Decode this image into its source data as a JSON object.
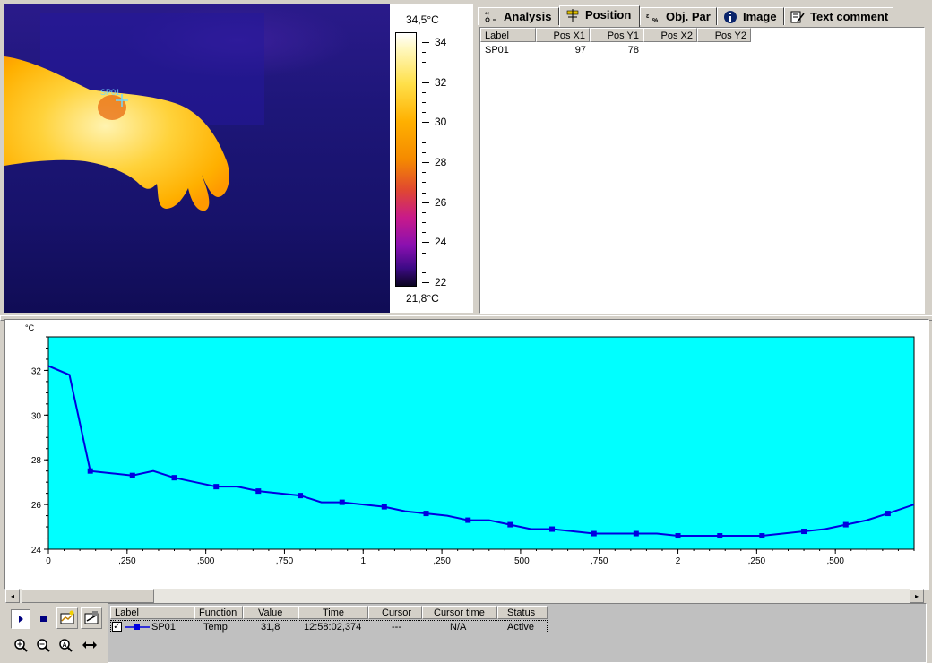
{
  "thermal": {
    "spot_label": "SP01",
    "scale_max": "34,5°C",
    "scale_min": "21,8°C",
    "scale_ticks": [
      "34",
      "32",
      "30",
      "28",
      "26",
      "24",
      "22"
    ]
  },
  "tabs": [
    {
      "label": "Analysis",
      "icon": "analysis-icon"
    },
    {
      "label": "Position",
      "icon": "position-icon"
    },
    {
      "label": "Obj. Par",
      "icon": "object-parameters-icon"
    },
    {
      "label": "Image",
      "icon": "info-icon"
    },
    {
      "label": "Text comment",
      "icon": "text-comment-icon"
    }
  ],
  "position_table": {
    "headers": [
      "Label",
      "Pos X1",
      "Pos Y1",
      "Pos X2",
      "Pos Y2"
    ],
    "rows": [
      [
        "SP01",
        "97",
        "78",
        "",
        ""
      ]
    ]
  },
  "chart_data": {
    "type": "line",
    "ylabel": "°C",
    "ylim": [
      24,
      33.5
    ],
    "yticks": [
      24,
      26,
      28,
      30,
      32
    ],
    "xlim": [
      0,
      2.75
    ],
    "xtick_labels": [
      "0",
      ",250",
      ",500",
      ",750",
      "1",
      ",250",
      ",500",
      ",750",
      "2",
      ",250",
      ",500"
    ],
    "xtick_values": [
      0,
      0.25,
      0.5,
      0.75,
      1,
      1.25,
      1.5,
      1.75,
      2,
      2.25,
      2.5
    ],
    "grid": false,
    "background": "#00ffff",
    "line_color": "#0000e0",
    "series": [
      {
        "x": [
          0,
          0.067,
          0.133,
          0.2,
          0.267,
          0.333,
          0.4,
          0.467,
          0.533,
          0.6,
          0.667,
          0.733,
          0.8,
          0.867,
          0.933,
          1.0,
          1.067,
          1.133,
          1.2,
          1.267,
          1.333,
          1.4,
          1.467,
          1.533,
          1.6,
          1.667,
          1.733,
          1.8,
          1.867,
          1.933,
          2.0,
          2.067,
          2.133,
          2.2,
          2.267,
          2.333,
          2.4,
          2.467,
          2.533,
          2.6,
          2.667,
          2.75
        ],
        "values": [
          32.2,
          31.8,
          27.5,
          27.4,
          27.3,
          27.5,
          27.2,
          27.0,
          26.8,
          26.8,
          26.6,
          26.5,
          26.4,
          26.1,
          26.1,
          26.0,
          25.9,
          25.7,
          25.6,
          25.5,
          25.3,
          25.3,
          25.1,
          24.9,
          24.9,
          24.8,
          24.7,
          24.7,
          24.7,
          24.7,
          24.6,
          24.6,
          24.6,
          24.6,
          24.6,
          24.7,
          24.8,
          24.9,
          25.1,
          25.3,
          25.6,
          26.0
        ],
        "marker_every": 2
      }
    ]
  },
  "legend_list": {
    "headers": [
      "Label",
      "Function",
      "Value",
      "Time",
      "Cursor",
      "Cursor time",
      "Status"
    ],
    "rows": [
      {
        "checked": true,
        "label": "SP01",
        "function": "Temp",
        "value": "31,8",
        "time": "12:58:02,374",
        "cursor": "---",
        "cursor_time": "N/A",
        "status": "Active"
      }
    ]
  },
  "toolbar": {
    "buttons": [
      "play-icon",
      "stop-icon",
      "chart-settings-icon",
      "export-icon",
      "zoom-in-icon",
      "zoom-out-icon",
      "zoom-fit-icon",
      "pan-horizontal-icon"
    ]
  }
}
